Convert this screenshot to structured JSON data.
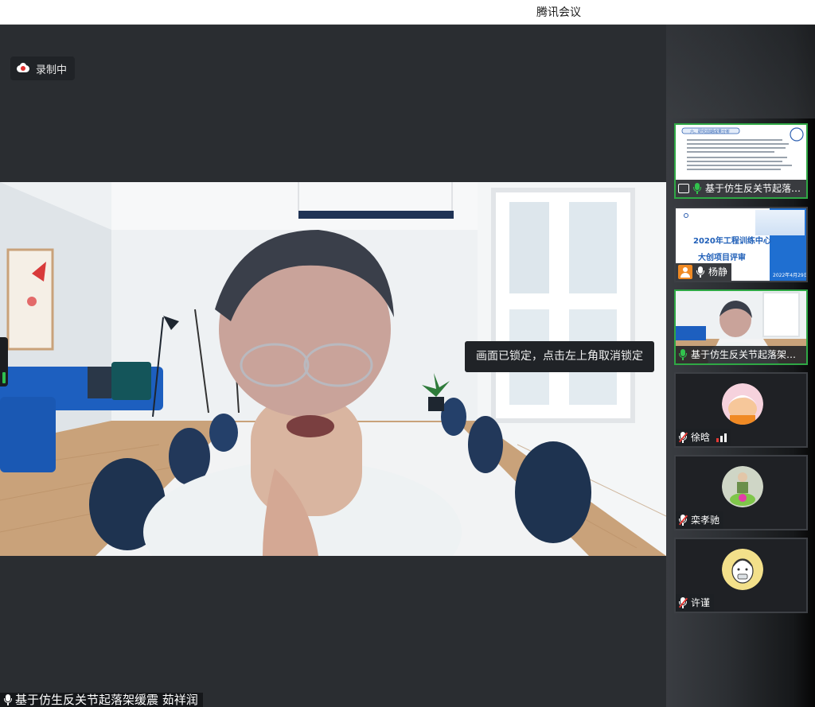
{
  "window": {
    "title": "腾讯会议"
  },
  "recording": {
    "label": "录制中",
    "icon": "cloud-record-icon"
  },
  "lock_notice": {
    "text": "画面已锁定，点击左上角取消锁定"
  },
  "main_video": {
    "name_label": "基于仿生反关节起落架缓震 茹祥润",
    "mic_icon": "mic-icon"
  },
  "sidebar": {
    "tiles": [
      {
        "name": "基于仿生反关节起落架...",
        "kind": "screen-share",
        "speaking": true,
        "mic": "on",
        "slide": {
          "header": "六、研究前期成果分析"
        }
      },
      {
        "name": "杨静",
        "kind": "slide",
        "speaking": false,
        "mic": "on",
        "slide": {
          "line1": "2020年工程训练中心",
          "line2": "大创项目评审",
          "date": "2022年4月29日"
        }
      },
      {
        "name": "基于仿生反关节起落架缓震...",
        "kind": "camera",
        "speaking": true,
        "mic": "on"
      },
      {
        "name": "徐晗",
        "kind": "avatar",
        "speaking": false,
        "mic": "muted",
        "signal_level": 3
      },
      {
        "name": "栾孝驰",
        "kind": "avatar",
        "speaking": false,
        "mic": "muted"
      },
      {
        "name": "许谨",
        "kind": "avatar",
        "speaking": false,
        "mic": "muted"
      }
    ]
  },
  "colors": {
    "speaking_border": "#2fa845",
    "muted_red": "#e53935",
    "brand_blue": "#1f6fd1"
  }
}
